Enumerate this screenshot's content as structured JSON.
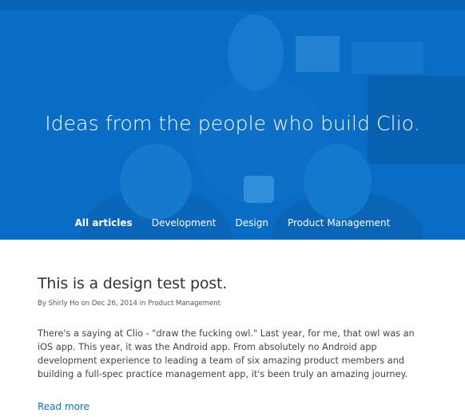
{
  "hero": {
    "title": "Ideas from the people who build Clio."
  },
  "nav": {
    "items": [
      {
        "label": "All articles",
        "active": true
      },
      {
        "label": "Development",
        "active": false
      },
      {
        "label": "Design",
        "active": false
      },
      {
        "label": "Product Management",
        "active": false
      }
    ]
  },
  "post": {
    "title": "This is a design test post.",
    "meta": "By Shirly Ho on Dec 26, 2014 in Product Management",
    "excerpt": "There's a saying at Clio - \"draw the fucking owl.\" Last year, for me, that owl was an iOS app. This year, it was the Android app. From absolutely no Android app development experience to leading a team of six amazing product members and building a full-spec practice management app, it's been truly an amazing journey.",
    "read_more": "Read more"
  },
  "colors": {
    "hero_blue": "#0b6fc7",
    "link_blue": "#0a74c9"
  }
}
